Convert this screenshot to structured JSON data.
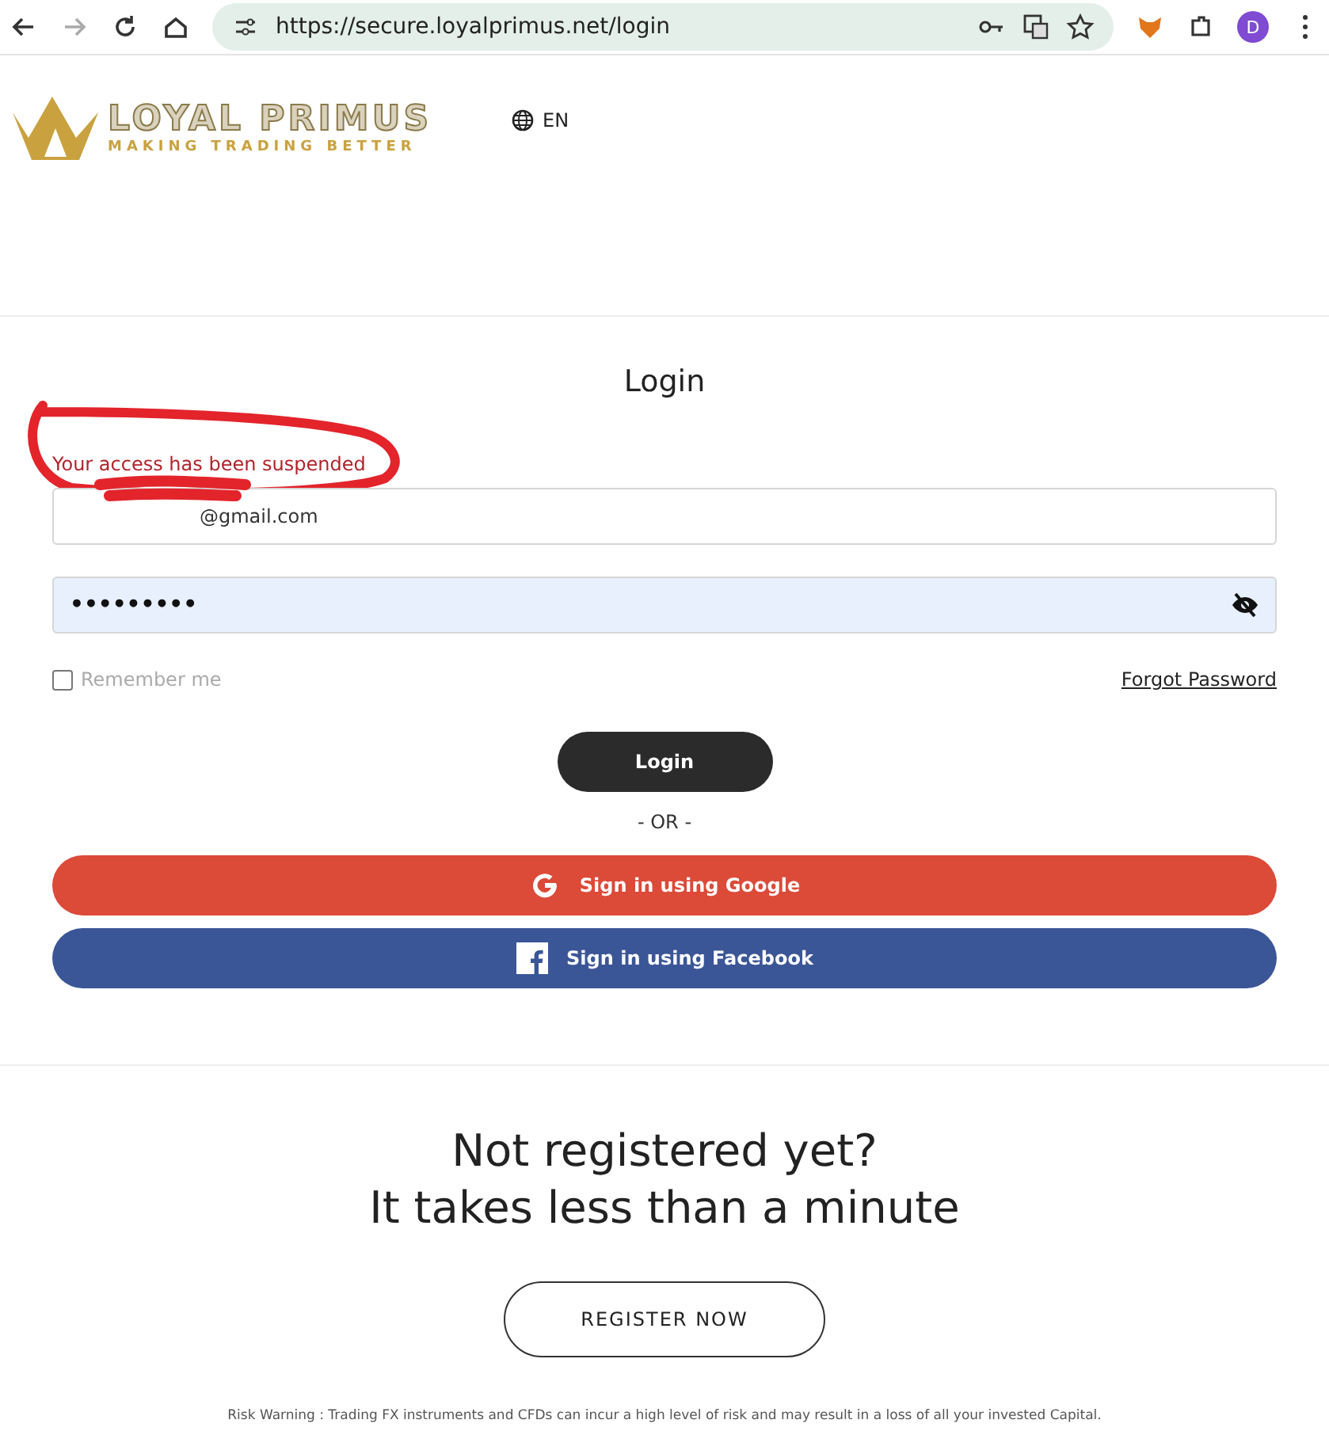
{
  "browser": {
    "url": "https://secure.loyalprimus.net/login",
    "profile_initial": "D"
  },
  "header": {
    "logo_title": "LOYAL PRIMUS",
    "logo_tagline": "MAKING TRADING BETTER",
    "language": "EN"
  },
  "login": {
    "title": "Login",
    "error": "Your access has been suspended",
    "email": "@gmail.com",
    "password": "•••••••••",
    "remember_label": "Remember me",
    "remember_checked": false,
    "forgot": "Forgot Password",
    "submit": "Login",
    "or": "- OR -",
    "social": [
      {
        "kind": "google",
        "label": "Sign in using Google",
        "color": "#dc4a38"
      },
      {
        "kind": "facebook",
        "label": "Sign in using Facebook",
        "color": "#3b5697"
      }
    ]
  },
  "register": {
    "line1": "Not registered yet?",
    "line2": "It takes less than a minute",
    "button": "REGISTER NOW"
  },
  "risk_warning": "Risk Warning : Trading FX instruments and CFDs can incur a high level of risk and may result in a loss of all your invested Capital."
}
